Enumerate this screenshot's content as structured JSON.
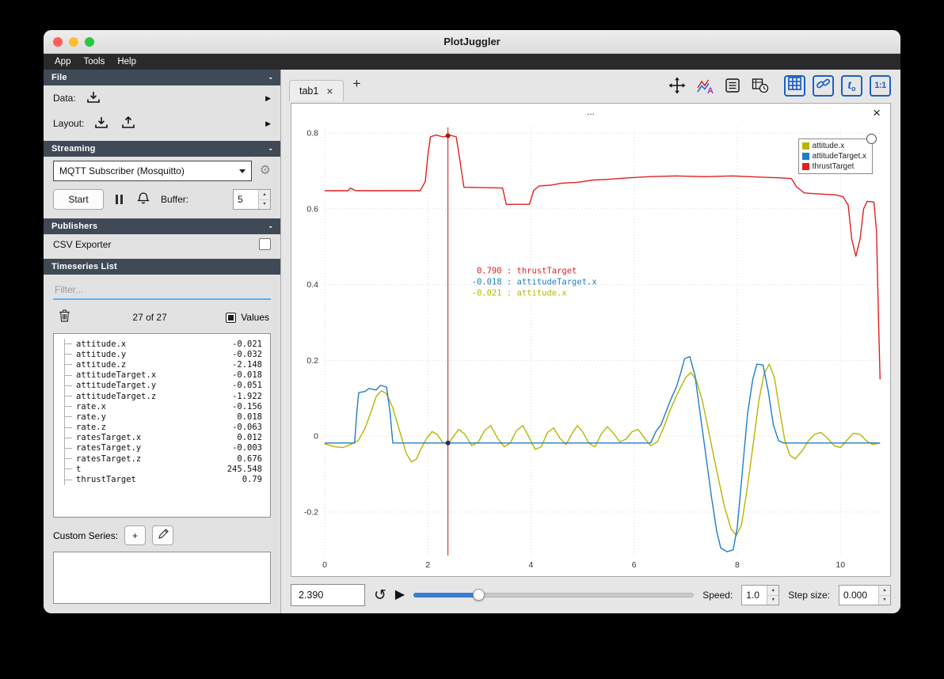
{
  "window": {
    "title": "PlotJuggler",
    "menu": [
      "App",
      "Tools",
      "Help"
    ]
  },
  "glyphs": {
    "arrow_right": "▶",
    "plus": "+",
    "close": "×",
    "loop": "↺",
    "play": "▶",
    "gear": "⚙",
    "up": "▲",
    "down": "▼",
    "collapse": "-"
  },
  "sidebar": {
    "sections": {
      "file": "File",
      "streaming": "Streaming",
      "publishers": "Publishers",
      "timeseries": "Timeseries List"
    },
    "data_label": "Data:",
    "layout_label": "Layout:",
    "streaming_source": "MQTT Subscriber (Mosquitto)",
    "start_button": "Start",
    "buffer_label": "Buffer:",
    "buffer_value": "5",
    "csv_exporter_label": "CSV Exporter",
    "filter_placeholder": "Filter...",
    "count_label": "27 of 27",
    "values_label": "Values",
    "custom_series_label": "Custom Series:",
    "series": [
      {
        "name": "attitude.x",
        "value": "-0.021"
      },
      {
        "name": "attitude.y",
        "value": "-0.032"
      },
      {
        "name": "attitude.z",
        "value": "-2.148"
      },
      {
        "name": "attitudeTarget.x",
        "value": "-0.018"
      },
      {
        "name": "attitudeTarget.y",
        "value": "-0.051"
      },
      {
        "name": "attitudeTarget.z",
        "value": "-1.922"
      },
      {
        "name": "rate.x",
        "value": "-0.156"
      },
      {
        "name": "rate.y",
        "value": "0.018"
      },
      {
        "name": "rate.z",
        "value": "-0.063"
      },
      {
        "name": "ratesTarget.x",
        "value": "0.012"
      },
      {
        "name": "ratesTarget.y",
        "value": "-0.003"
      },
      {
        "name": "ratesTarget.z",
        "value": "0.676"
      },
      {
        "name": "t",
        "value": "245.548"
      },
      {
        "name": "thrustTarget",
        "value": "0.79"
      }
    ]
  },
  "main": {
    "tab": {
      "label": "tab1"
    },
    "toolbar": {
      "t0_base": "t",
      "t0_sub": "o",
      "ratio": "1:1"
    },
    "plot": {
      "title": "...",
      "legend": [
        {
          "label": "attitude.x",
          "color": "#b9b400"
        },
        {
          "label": "attitudeTarget.x",
          "color": "#1c7ec8"
        },
        {
          "label": "thrustTarget",
          "color": "#e01f1f"
        }
      ],
      "tracker": {
        "time": 2.39,
        "readouts": [
          {
            "value": " 0.790",
            "name": "thrustTarget",
            "color": "#e01f1f"
          },
          {
            "value": "-0.018",
            "name": "attitudeTarget.x",
            "color": "#1c7ec8"
          },
          {
            "value": "-0.021",
            "name": "attitude.x",
            "color": "#b9b400"
          }
        ]
      }
    }
  },
  "playback": {
    "time_value": "2.390",
    "speed_label": "Speed:",
    "speed_value": "1.0",
    "step_label": "Step size:",
    "step_value": "0.000",
    "slider_fraction": 0.234
  },
  "chart_data": {
    "type": "line",
    "title": "...",
    "xlabel": "",
    "ylabel": "",
    "xlim": [
      0,
      10.78
    ],
    "ylim": [
      -0.315,
      0.815
    ],
    "xticks": [
      0,
      2,
      4,
      6,
      8,
      10
    ],
    "yticks": [
      -0.2,
      0,
      0.2,
      0.4,
      0.6,
      0.8
    ],
    "grid": true,
    "legend_position": "top-right",
    "tracker_x": 2.39,
    "markers": [
      {
        "x": 2.39,
        "y": 0.793,
        "color": "#b01515"
      },
      {
        "x": 2.39,
        "y": -0.018,
        "color": "#1a2f63"
      }
    ],
    "series": [
      {
        "name": "attitude.x",
        "color": "#b9b400",
        "points": [
          [
            0,
            -0.02
          ],
          [
            0.2,
            -0.028
          ],
          [
            0.35,
            -0.03
          ],
          [
            0.5,
            -0.022
          ],
          [
            0.65,
            -0.012
          ],
          [
            0.78,
            0.02
          ],
          [
            0.9,
            0.065
          ],
          [
            1.0,
            0.105
          ],
          [
            1.1,
            0.12
          ],
          [
            1.2,
            0.112
          ],
          [
            1.32,
            0.075
          ],
          [
            1.45,
            0.015
          ],
          [
            1.58,
            -0.045
          ],
          [
            1.68,
            -0.068
          ],
          [
            1.78,
            -0.06
          ],
          [
            1.88,
            -0.03
          ],
          [
            1.98,
            -0.005
          ],
          [
            2.08,
            0.012
          ],
          [
            2.18,
            0.005
          ],
          [
            2.28,
            -0.015
          ],
          [
            2.39,
            -0.021
          ],
          [
            2.5,
            0.0
          ],
          [
            2.6,
            0.018
          ],
          [
            2.72,
            0.005
          ],
          [
            2.85,
            -0.025
          ],
          [
            2.98,
            -0.015
          ],
          [
            3.1,
            0.015
          ],
          [
            3.22,
            0.028
          ],
          [
            3.35,
            -0.005
          ],
          [
            3.48,
            -0.028
          ],
          [
            3.6,
            -0.018
          ],
          [
            3.72,
            0.015
          ],
          [
            3.84,
            0.028
          ],
          [
            3.96,
            -0.002
          ],
          [
            4.08,
            -0.035
          ],
          [
            4.2,
            -0.028
          ],
          [
            4.32,
            0.01
          ],
          [
            4.44,
            0.022
          ],
          [
            4.56,
            -0.005
          ],
          [
            4.68,
            -0.022
          ],
          [
            4.8,
            0.008
          ],
          [
            4.9,
            0.028
          ],
          [
            5.0,
            0.012
          ],
          [
            5.12,
            -0.018
          ],
          [
            5.24,
            -0.028
          ],
          [
            5.36,
            0.005
          ],
          [
            5.48,
            0.025
          ],
          [
            5.6,
            0.008
          ],
          [
            5.72,
            -0.015
          ],
          [
            5.84,
            -0.008
          ],
          [
            5.96,
            0.012
          ],
          [
            6.08,
            0.018
          ],
          [
            6.2,
            -0.005
          ],
          [
            6.32,
            -0.025
          ],
          [
            6.45,
            -0.015
          ],
          [
            6.58,
            0.025
          ],
          [
            6.7,
            0.07
          ],
          [
            6.85,
            0.115
          ],
          [
            7.0,
            0.155
          ],
          [
            7.1,
            0.168
          ],
          [
            7.2,
            0.15
          ],
          [
            7.32,
            0.095
          ],
          [
            7.45,
            0.01
          ],
          [
            7.6,
            -0.09
          ],
          [
            7.75,
            -0.185
          ],
          [
            7.88,
            -0.245
          ],
          [
            7.98,
            -0.262
          ],
          [
            8.08,
            -0.235
          ],
          [
            8.18,
            -0.15
          ],
          [
            8.3,
            -0.03
          ],
          [
            8.42,
            0.095
          ],
          [
            8.52,
            0.165
          ],
          [
            8.62,
            0.19
          ],
          [
            8.72,
            0.155
          ],
          [
            8.82,
            0.07
          ],
          [
            8.92,
            -0.01
          ],
          [
            9.02,
            -0.05
          ],
          [
            9.12,
            -0.06
          ],
          [
            9.25,
            -0.04
          ],
          [
            9.38,
            -0.012
          ],
          [
            9.5,
            0.005
          ],
          [
            9.62,
            0.01
          ],
          [
            9.75,
            -0.005
          ],
          [
            9.88,
            -0.025
          ],
          [
            10.0,
            -0.03
          ],
          [
            10.12,
            -0.012
          ],
          [
            10.25,
            0.008
          ],
          [
            10.38,
            0.005
          ],
          [
            10.5,
            -0.012
          ],
          [
            10.62,
            -0.022
          ],
          [
            10.77,
            -0.018
          ]
        ]
      },
      {
        "name": "attitudeTarget.x",
        "color": "#1c7ec8",
        "points": [
          [
            0,
            -0.018
          ],
          [
            0.58,
            -0.018
          ],
          [
            0.62,
            0.06
          ],
          [
            0.66,
            0.115
          ],
          [
            0.78,
            0.118
          ],
          [
            0.86,
            0.126
          ],
          [
            1.0,
            0.122
          ],
          [
            1.08,
            0.134
          ],
          [
            1.2,
            0.13
          ],
          [
            1.27,
            0.06
          ],
          [
            1.32,
            -0.018
          ],
          [
            2.0,
            -0.018
          ],
          [
            3.0,
            -0.018
          ],
          [
            4.0,
            -0.018
          ],
          [
            5.0,
            -0.018
          ],
          [
            6.32,
            -0.018
          ],
          [
            6.42,
            0.012
          ],
          [
            6.52,
            0.03
          ],
          [
            6.62,
            0.065
          ],
          [
            6.72,
            0.1
          ],
          [
            6.82,
            0.13
          ],
          [
            6.9,
            0.165
          ],
          [
            6.98,
            0.205
          ],
          [
            7.08,
            0.21
          ],
          [
            7.18,
            0.16
          ],
          [
            7.28,
            0.06
          ],
          [
            7.38,
            -0.04
          ],
          [
            7.5,
            -0.16
          ],
          [
            7.6,
            -0.25
          ],
          [
            7.68,
            -0.295
          ],
          [
            7.8,
            -0.305
          ],
          [
            7.92,
            -0.3
          ],
          [
            8.0,
            -0.24
          ],
          [
            8.1,
            -0.09
          ],
          [
            8.2,
            0.06
          ],
          [
            8.3,
            0.15
          ],
          [
            8.38,
            0.19
          ],
          [
            8.5,
            0.188
          ],
          [
            8.6,
            0.12
          ],
          [
            8.7,
            0.03
          ],
          [
            8.8,
            -0.012
          ],
          [
            8.9,
            -0.018
          ],
          [
            10.77,
            -0.018
          ]
        ]
      },
      {
        "name": "thrustTarget",
        "color": "#e01f1f",
        "points": [
          [
            0,
            0.648
          ],
          [
            0.45,
            0.648
          ],
          [
            0.5,
            0.655
          ],
          [
            0.6,
            0.648
          ],
          [
            1.85,
            0.648
          ],
          [
            1.95,
            0.672
          ],
          [
            2.0,
            0.74
          ],
          [
            2.05,
            0.79
          ],
          [
            2.15,
            0.795
          ],
          [
            2.3,
            0.79
          ],
          [
            2.42,
            0.795
          ],
          [
            2.55,
            0.79
          ],
          [
            2.62,
            0.73
          ],
          [
            2.7,
            0.657
          ],
          [
            3.45,
            0.655
          ],
          [
            3.52,
            0.612
          ],
          [
            3.97,
            0.612
          ],
          [
            4.05,
            0.648
          ],
          [
            4.15,
            0.66
          ],
          [
            4.4,
            0.663
          ],
          [
            4.6,
            0.668
          ],
          [
            4.9,
            0.67
          ],
          [
            5.2,
            0.676
          ],
          [
            5.5,
            0.678
          ],
          [
            5.9,
            0.682
          ],
          [
            6.3,
            0.685
          ],
          [
            6.8,
            0.687
          ],
          [
            7.4,
            0.685
          ],
          [
            7.9,
            0.687
          ],
          [
            8.4,
            0.684
          ],
          [
            8.8,
            0.682
          ],
          [
            9.05,
            0.68
          ],
          [
            9.15,
            0.658
          ],
          [
            9.3,
            0.642
          ],
          [
            9.5,
            0.64
          ],
          [
            9.9,
            0.637
          ],
          [
            10.05,
            0.632
          ],
          [
            10.15,
            0.61
          ],
          [
            10.22,
            0.52
          ],
          [
            10.3,
            0.475
          ],
          [
            10.38,
            0.52
          ],
          [
            10.45,
            0.6
          ],
          [
            10.52,
            0.62
          ],
          [
            10.65,
            0.618
          ],
          [
            10.7,
            0.54
          ],
          [
            10.74,
            0.3
          ],
          [
            10.77,
            0.15
          ]
        ]
      }
    ]
  }
}
